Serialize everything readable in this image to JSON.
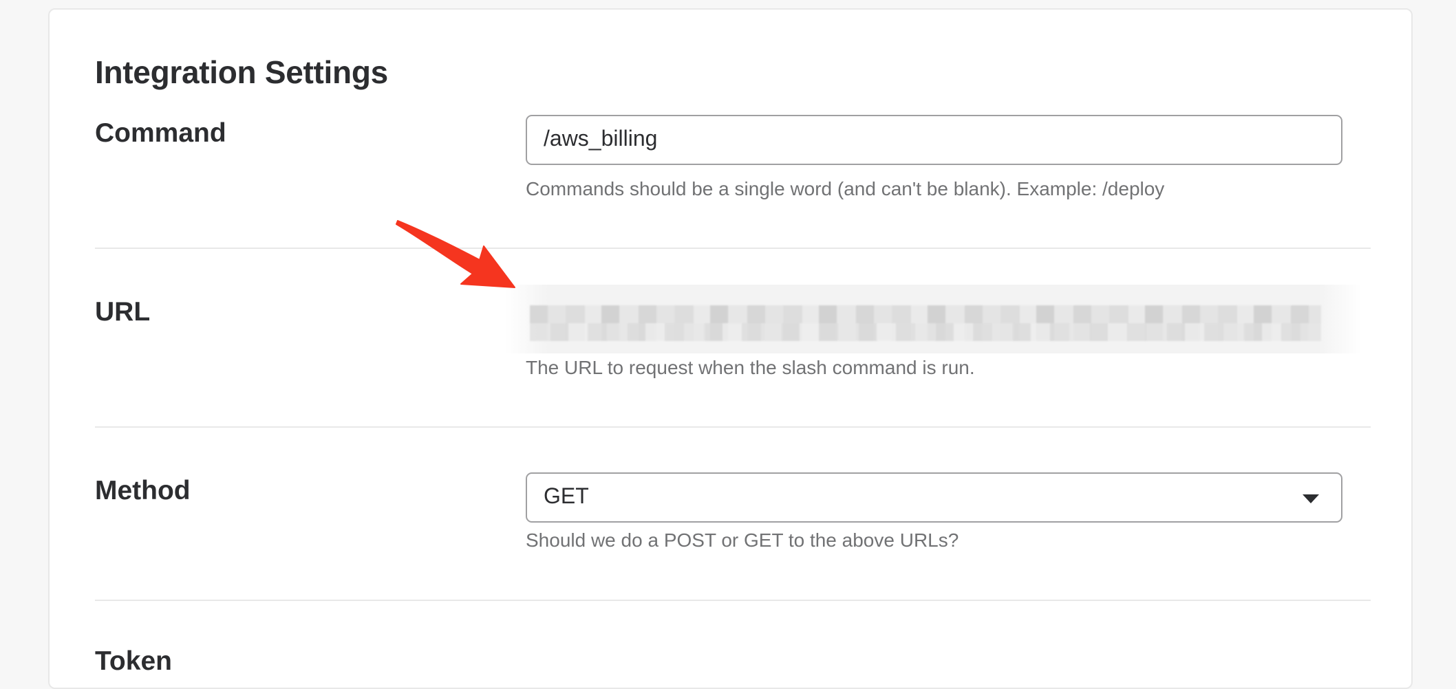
{
  "page": {
    "title": "Integration Settings"
  },
  "command": {
    "label": "Command",
    "value": "/aws_billing",
    "help": "Commands should be a single word (and can't be blank). Example: /deploy"
  },
  "url": {
    "label": "URL",
    "help": "The URL to request when the slash command is run."
  },
  "method": {
    "label": "Method",
    "selected": "GET",
    "help": "Should we do a POST or GET to the above URLs?"
  },
  "token": {
    "label": "Token"
  },
  "annotation": {
    "arrow_color": "#f5351f",
    "icon": "red-arrow-pointer"
  }
}
